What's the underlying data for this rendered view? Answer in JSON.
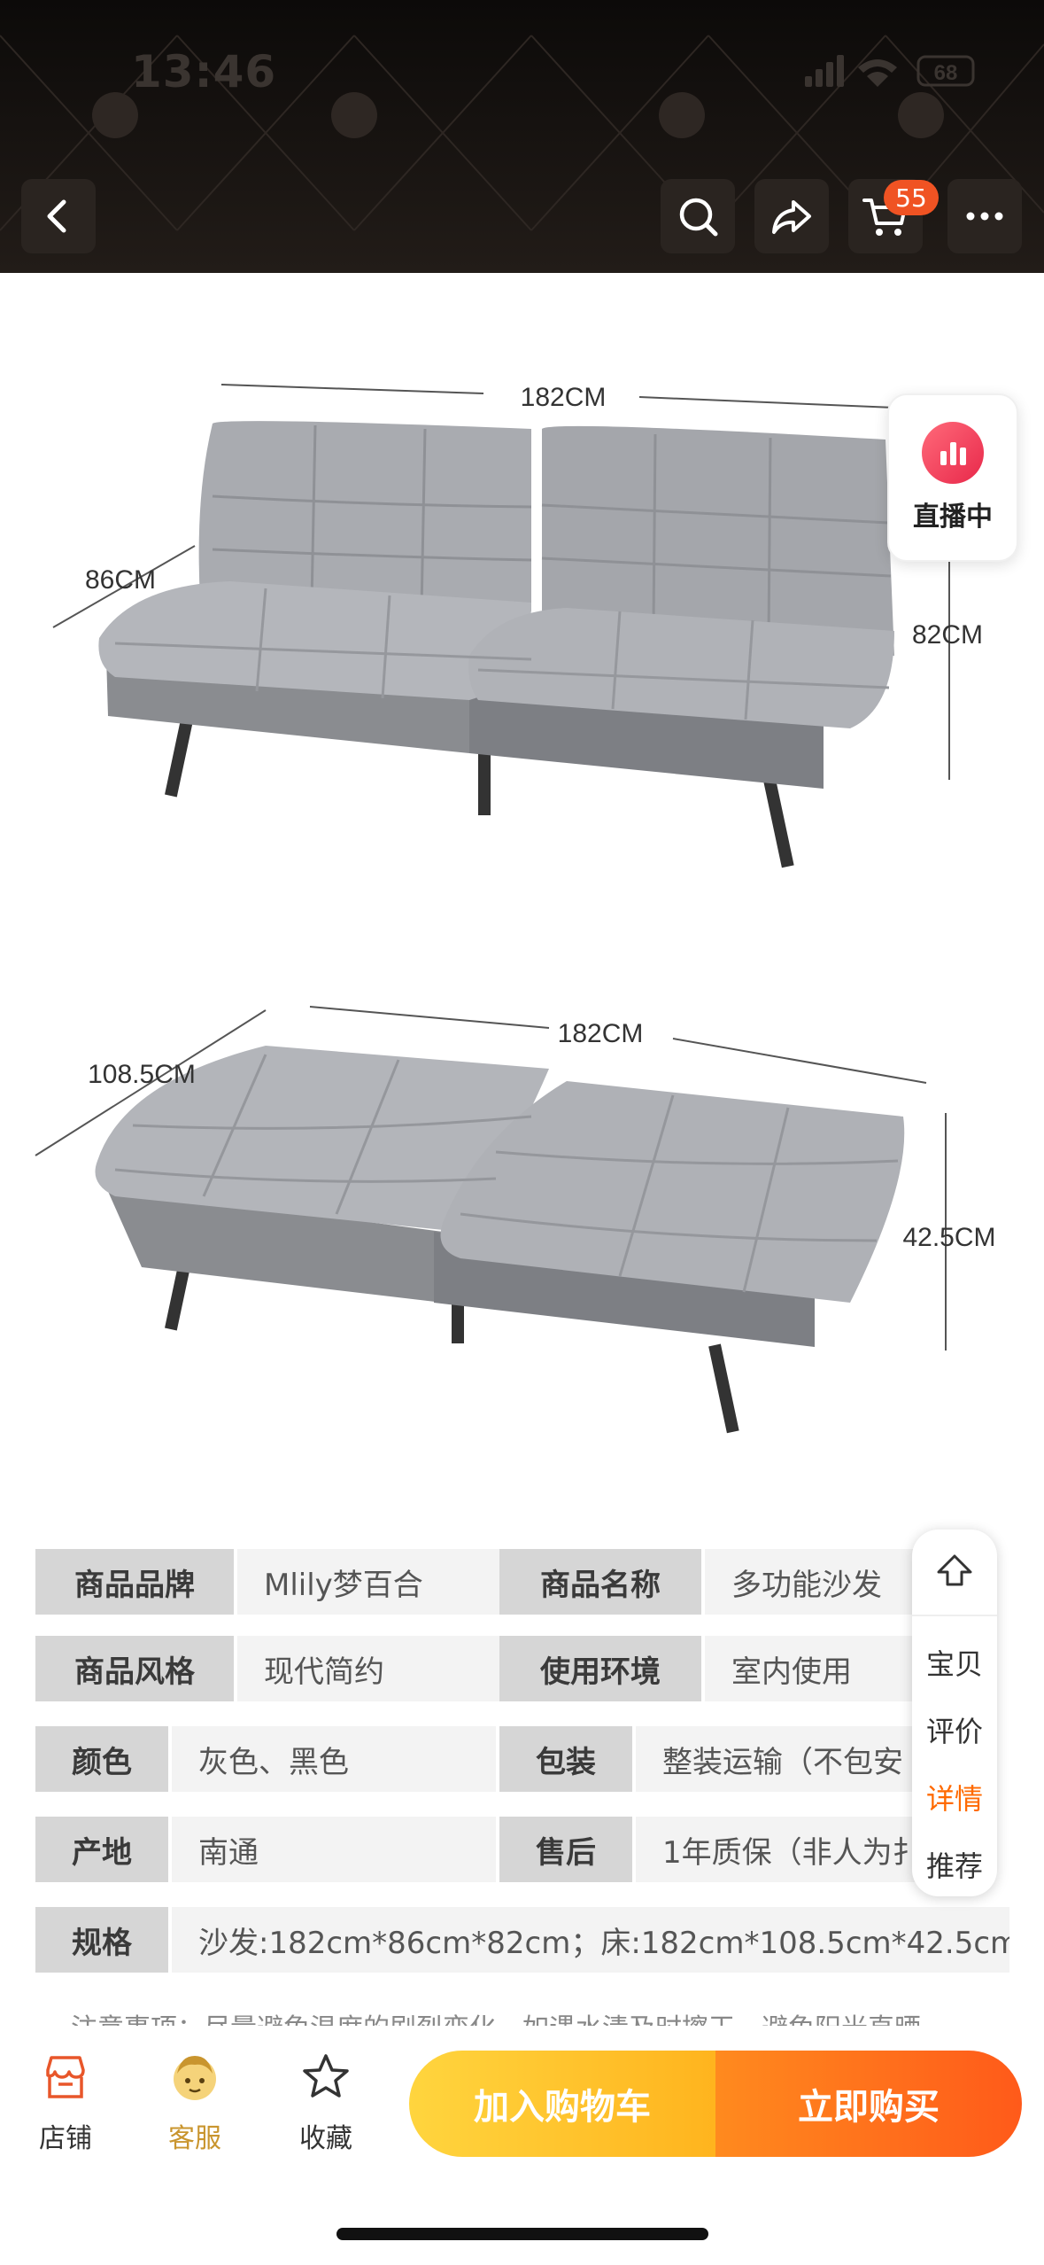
{
  "status_bar": {
    "time": "13:46",
    "battery": "68"
  },
  "nav": {
    "cart_count": "55"
  },
  "product_image": {
    "dim_top_width": "182CM",
    "dim_top_depth": "86CM",
    "dim_top_height": "82CM",
    "dim_bottom_width": "182CM",
    "dim_bottom_depth": "108.5CM",
    "dim_bottom_height": "42.5CM"
  },
  "live": {
    "label": "直播中"
  },
  "specs": [
    {
      "k1": "商品品牌",
      "v1": "Mlily梦百合",
      "k2": "商品名称",
      "v2": "多功能沙发"
    },
    {
      "k1": "商品风格",
      "v1": "现代简约",
      "k2": "使用环境",
      "v2": "室内使用"
    },
    {
      "k1": "颜色",
      "v1": "灰色、黑色",
      "k2": "包装",
      "v2": "整装运输（不包安"
    },
    {
      "k1": "产地",
      "v1": "南通",
      "k2": "售后",
      "v2": "1年质保（非人为扌"
    },
    {
      "k1": "规格",
      "v1": "沙发:182cm*86cm*82cm；床:182cm*108.5cm*42.5cm"
    }
  ],
  "note": "注意事项：尽量避免温度的剧烈变化，如遇水渍及时擦干，避免阳光直晒",
  "side_nav": [
    "宝贝",
    "评价",
    "详情",
    "推荐"
  ],
  "bottom": {
    "store": "店铺",
    "service": "客服",
    "favorite": "收藏",
    "add_cart": "加入购物车",
    "buy_now": "立即购买"
  },
  "colors": {
    "accent": "#ff6a00",
    "badge": "#f05323",
    "cart_button": "#ffc52e",
    "buy_button": "#ff6a1e"
  }
}
